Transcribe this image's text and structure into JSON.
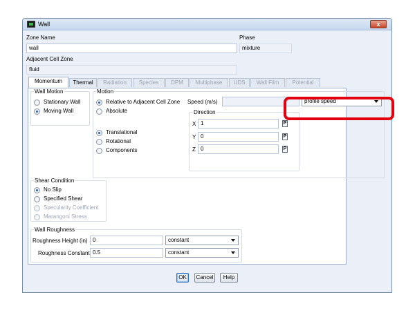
{
  "window": {
    "title": "Wall",
    "close_glyph": "x"
  },
  "zone_name": {
    "label": "Zone Name",
    "value": "wall"
  },
  "phase": {
    "label": "Phase",
    "value": "mixture"
  },
  "adjacent_cell_zone": {
    "label": "Adjacent Cell Zone",
    "value": "fluid"
  },
  "tabs": [
    {
      "label": "Momentum",
      "state": "active"
    },
    {
      "label": "Thermal",
      "state": "enabled"
    },
    {
      "label": "Radiation",
      "state": "disabled"
    },
    {
      "label": "Species",
      "state": "disabled"
    },
    {
      "label": "DPM",
      "state": "disabled"
    },
    {
      "label": "Multiphase",
      "state": "disabled"
    },
    {
      "label": "UDS",
      "state": "disabled"
    },
    {
      "label": "Wall Film",
      "state": "disabled"
    },
    {
      "label": "Potential",
      "state": "disabled"
    }
  ],
  "wall_motion": {
    "title": "Wall Motion",
    "options": [
      "Stationary Wall",
      "Moving Wall"
    ],
    "selected": "Moving Wall"
  },
  "motion": {
    "title": "Motion",
    "reference_options": [
      "Relative to Adjacent Cell Zone",
      "Absolute"
    ],
    "reference_selected": "Relative to Adjacent Cell Zone",
    "type_options": [
      "Translational",
      "Rotational",
      "Components"
    ],
    "type_selected": "Translational",
    "speed_label": "Speed (m/s)",
    "speed_profile": "profile speed",
    "direction": {
      "title": "Direction",
      "x_label": "X",
      "x_value": "1",
      "y_label": "Y",
      "y_value": "0",
      "z_label": "Z",
      "z_value": "0",
      "profile_button": "P"
    }
  },
  "shear_condition": {
    "title": "Shear Condition",
    "options": [
      "No Slip",
      "Specified Shear",
      "Specularity Coefficient",
      "Marangoni Stress"
    ],
    "selected": "No Slip"
  },
  "wall_roughness": {
    "title": "Wall Roughness",
    "height_label": "Roughness Height (in)",
    "height_value": "0",
    "height_method": "constant",
    "constant_label": "Roughness Constant",
    "constant_value": "0.5",
    "constant_method": "constant"
  },
  "buttons": {
    "ok": "OK",
    "cancel": "Cancel",
    "help": "Help"
  },
  "colors": {
    "highlight": "#e3000f",
    "accent": "#2a5ea8"
  }
}
